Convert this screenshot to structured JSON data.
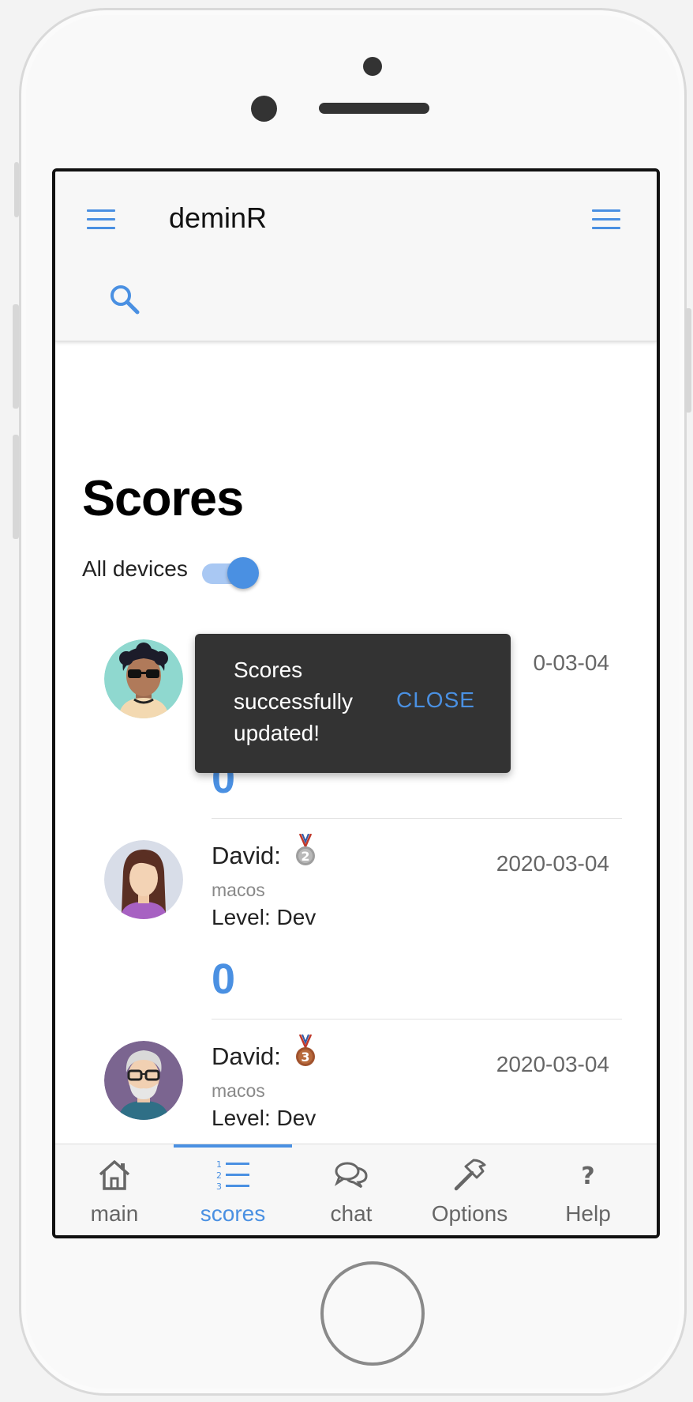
{
  "app": {
    "title": "deminR"
  },
  "page": {
    "title": "Scores"
  },
  "filter": {
    "label": "All devices",
    "enabled": true
  },
  "scores": [
    {
      "name": "",
      "device": "",
      "level": "",
      "date": "0-03-04",
      "score": "0",
      "medal": ""
    },
    {
      "name": "David:",
      "device": "macos",
      "level": "Level: Dev",
      "date": "2020-03-04",
      "score": "0",
      "medal": "2"
    },
    {
      "name": "David:",
      "device": "macos",
      "level": "Level: Dev",
      "date": "2020-03-04",
      "score": "",
      "medal": "3"
    }
  ],
  "snackbar": {
    "message": "Scores successfully updated!",
    "action": "CLOSE"
  },
  "tabs": [
    {
      "label": "main",
      "icon": "home-icon"
    },
    {
      "label": "scores",
      "icon": "list-numbered-icon",
      "active": true
    },
    {
      "label": "chat",
      "icon": "chat-icon"
    },
    {
      "label": "Options",
      "icon": "hammer-icon"
    },
    {
      "label": "Help",
      "icon": "question-icon"
    }
  ],
  "colors": {
    "accent": "#4a90e2",
    "snackbar": "#333333",
    "bar": "#f7f7f7"
  }
}
